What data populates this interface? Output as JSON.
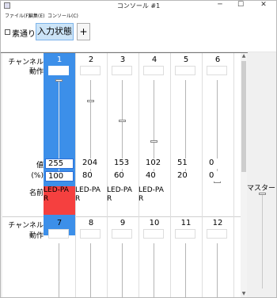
{
  "window": {
    "title": "コンソール #1",
    "minimize": "─",
    "maximize": "☐",
    "close": "✕"
  },
  "menu": {
    "items": [
      "ファイル(F)",
      "編集(E)",
      "コンソール(C)"
    ]
  },
  "toolbar": {
    "checkbox_label": "素通り",
    "tab_label": "入力状態",
    "add_label": "+"
  },
  "labels": {
    "channel": "チャンネル",
    "action": "動作",
    "value": "値",
    "percent": "(%)",
    "name": "名前",
    "master": "マスター"
  },
  "channels": [
    {
      "num": "1",
      "value": "255",
      "percent": "100",
      "name": "LED-PA",
      "name2": "R",
      "level": 1.0,
      "selected": true
    },
    {
      "num": "2",
      "value": "204",
      "percent": "80",
      "name": "LED-PA",
      "name2": "R",
      "level": 0.8
    },
    {
      "num": "3",
      "value": "153",
      "percent": "60",
      "name": "LED-PA",
      "name2": "R",
      "level": 0.6
    },
    {
      "num": "4",
      "value": "102",
      "percent": "40",
      "name": "LED-PA",
      "name2": "R",
      "level": 0.4
    },
    {
      "num": "5",
      "value": "51",
      "percent": "20",
      "name": "",
      "name2": "",
      "level": 0.2
    },
    {
      "num": "6",
      "value": "0",
      "percent": "0",
      "name": "",
      "name2": "",
      "level": 0.0
    }
  ],
  "channels2": [
    {
      "num": "7"
    },
    {
      "num": "8"
    },
    {
      "num": "9"
    },
    {
      "num": "10"
    },
    {
      "num": "11"
    },
    {
      "num": "12"
    }
  ],
  "colors": {
    "selected_column": "#3c8fe9",
    "selected_name": "#f5403f",
    "tab_active": "#cce4f7"
  },
  "master_level": 1.0
}
